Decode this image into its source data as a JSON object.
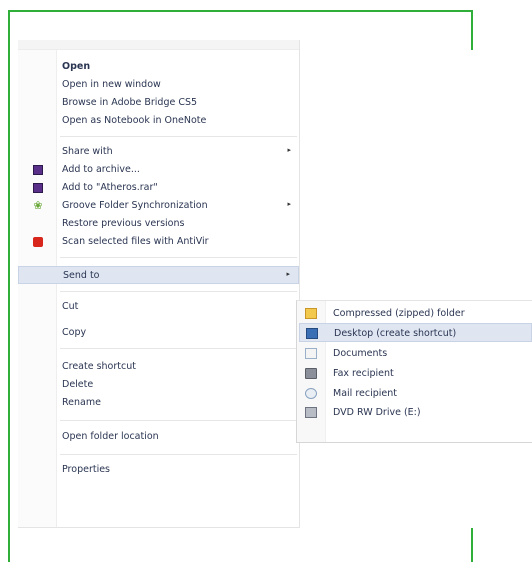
{
  "context_menu": {
    "items": [
      {
        "label": "Open",
        "bold": true
      },
      {
        "label": "Open in new window"
      },
      {
        "label": "Browse in Adobe Bridge CS5"
      },
      {
        "label": "Open as Notebook in OneNote"
      },
      {
        "label": "Share with",
        "submenu": true
      },
      {
        "label": "Add to archive...",
        "icon": "winrar-archive-icon"
      },
      {
        "label": "Add to \"Atheros.rar\"",
        "icon": "winrar-archive-icon"
      },
      {
        "label": "Groove Folder Synchronization",
        "icon": "groove-icon",
        "submenu": true
      },
      {
        "label": "Restore previous versions"
      },
      {
        "label": "Scan selected files with AntiVir",
        "icon": "antivir-icon"
      },
      {
        "label": "Send to",
        "submenu": true,
        "highlighted": true
      },
      {
        "label": "Cut"
      },
      {
        "label": "Copy"
      },
      {
        "label": "Create shortcut"
      },
      {
        "label": "Delete"
      },
      {
        "label": "Rename"
      },
      {
        "label": "Open folder location"
      },
      {
        "label": "Properties"
      }
    ],
    "submenu_arrow": "▸"
  },
  "send_to_submenu": {
    "items": [
      {
        "label": "Compressed (zipped) folder",
        "icon": "zip-folder-icon"
      },
      {
        "label": "Desktop (create shortcut)",
        "icon": "desktop-icon",
        "highlighted": true
      },
      {
        "label": "Documents",
        "icon": "documents-icon"
      },
      {
        "label": "Fax recipient",
        "icon": "fax-icon"
      },
      {
        "label": "Mail recipient",
        "icon": "mail-icon"
      },
      {
        "label": "DVD RW Drive (E:)",
        "icon": "dvd-drive-icon"
      }
    ]
  },
  "colors": {
    "frame": "#2fae3a",
    "highlight": "#dfe6f2",
    "text": "#2a3552"
  }
}
